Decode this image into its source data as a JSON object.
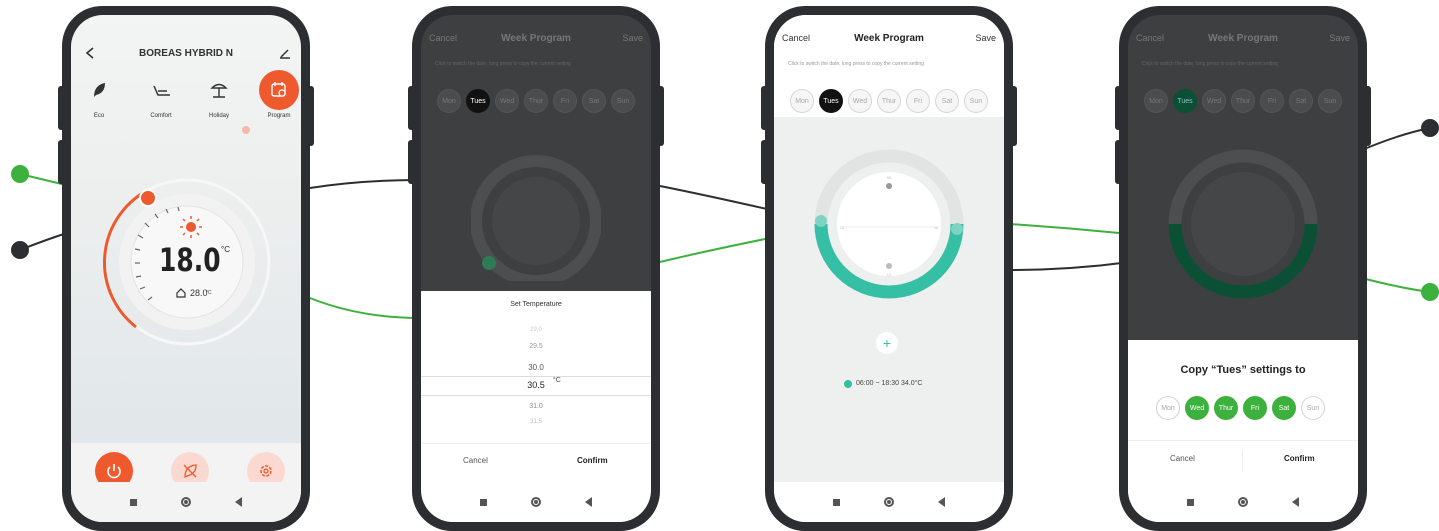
{
  "colors": {
    "green": "#3db13d",
    "dark": "#2c2e31",
    "accent": "#ee5a2e",
    "teal": "#35bfa5",
    "deep_green": "#0b4f35"
  },
  "phone1": {
    "back_icon": "chevron-left-icon",
    "device_name": "BOREAS HYBRID N",
    "edit_icon": "pencil-icon",
    "modes": [
      {
        "label": "Eco",
        "icon": "leaf-icon"
      },
      {
        "label": "Comfort",
        "icon": "armchair-icon"
      },
      {
        "label": "Holiday",
        "icon": "beach-umbrella-icon"
      },
      {
        "label": "Program",
        "icon": "calendar-clock-icon"
      }
    ],
    "temperature": "18.0",
    "temperature_unit": "°C",
    "home_temp": "28.0",
    "home_temp_unit": "°C",
    "bottom_icons": [
      "power-icon",
      "leaf-off-icon",
      "gear-icon"
    ]
  },
  "phone2": {
    "cancel": "Cancel",
    "title": "Week Program",
    "save": "Save",
    "hint": "Click to switch the date, long press to copy the current setting",
    "days": [
      "Mon",
      "Tues",
      "Wed",
      "Thur",
      "Fri",
      "Sat",
      "Sun"
    ],
    "selected_day": "Tues",
    "picker_title": "Set Temperature",
    "picker_values": [
      "29.0",
      "29.5",
      "30.0",
      "30.5",
      "31.0",
      "31.5"
    ],
    "picker_selected": "30.5",
    "picker_unit": "°C",
    "picker_cancel": "Cancel",
    "picker_confirm": "Confirm"
  },
  "phone3": {
    "cancel": "Cancel",
    "title": "Week Program",
    "save": "Save",
    "hint": "Click to switch the date, long press to copy the current setting",
    "days": [
      "Mon",
      "Tues",
      "Wed",
      "Thur",
      "Fri",
      "Sat",
      "Sun"
    ],
    "selected_day": "Tues",
    "clock_hours": [
      "00",
      "18",
      "06",
      "12"
    ],
    "schedule_entry": "06:00 ~ 18:30  34.0°C",
    "add_icon": "plus-icon"
  },
  "phone4": {
    "cancel": "Cancel",
    "title": "Week Program",
    "save": "Save",
    "hint": "Click to switch the date, long press to copy the current setting",
    "days": [
      "Mon",
      "Tues",
      "Wed",
      "Thur",
      "Fri",
      "Sat",
      "Sun"
    ],
    "copy_title": "Copy “Tues” settings to",
    "copy_days": [
      {
        "label": "Mon",
        "selected": false
      },
      {
        "label": "Wed",
        "selected": true
      },
      {
        "label": "Thur",
        "selected": true
      },
      {
        "label": "Fri",
        "selected": true
      },
      {
        "label": "Sat",
        "selected": true
      },
      {
        "label": "Sun",
        "selected": false
      }
    ],
    "copy_cancel": "Cancel",
    "copy_confirm": "Confirm"
  }
}
